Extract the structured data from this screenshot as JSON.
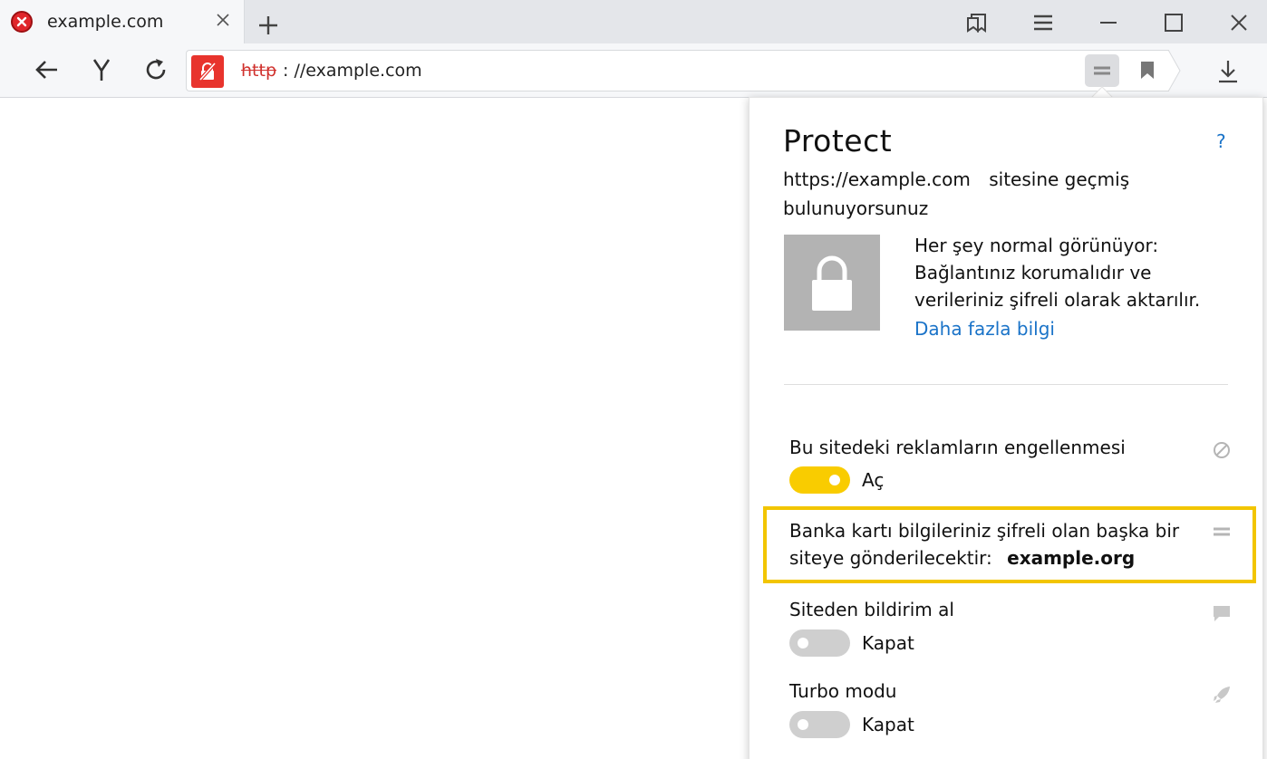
{
  "tab": {
    "title": "example.com",
    "favicon": "error-icon"
  },
  "address_bar": {
    "protocol": "http",
    "rest": ": //example.com"
  },
  "panel": {
    "title": "Protect",
    "help": "?",
    "site_url": "https://example.com",
    "site_text": "sitesine geçmiş bulunuyorsunuz",
    "status_text": "Her şey normal görünüyor: Bağlantınız korumalıdır ve verileriniz şifreli olarak aktarılır.",
    "more_link": "Daha fazla bilgi",
    "settings": {
      "ads": {
        "label": "Bu sitedeki reklamların engellenmesi",
        "state_label": "Aç",
        "on": true,
        "icon": "block-icon"
      },
      "card": {
        "text": "Banka kartı bilgileriniz şifreli olan başka bir siteye gönderilecektir:",
        "domain": "example.org",
        "icon": "card-icon"
      },
      "notifications": {
        "label": "Siteden bildirim al",
        "state_label": "Kapat",
        "on": false,
        "icon": "notification-icon"
      },
      "turbo": {
        "label": "Turbo modu",
        "state_label": "Kapat",
        "on": false,
        "icon": "rocket-icon"
      }
    }
  },
  "colors": {
    "accent_yellow": "#f9cc00",
    "link_blue": "#1a73c8",
    "warning_red": "#e8342d"
  }
}
